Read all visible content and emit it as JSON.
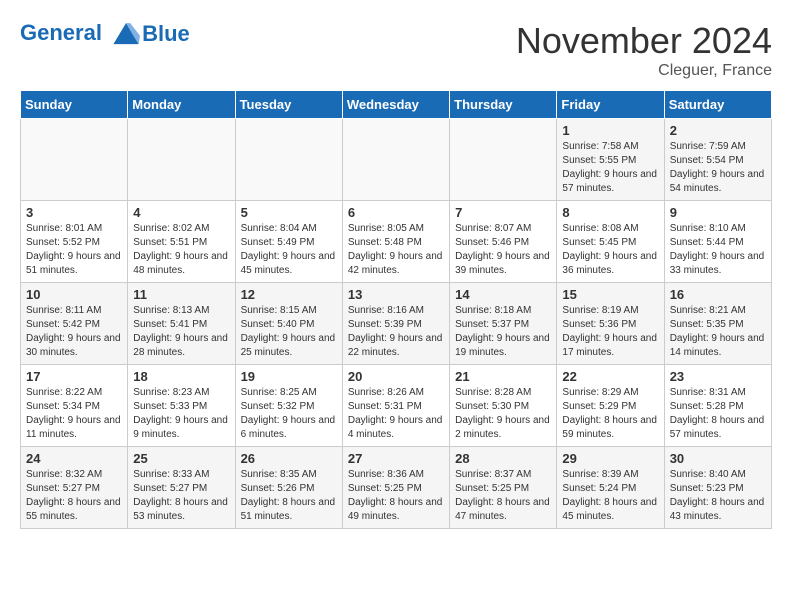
{
  "logo": {
    "line1": "General",
    "line2": "Blue"
  },
  "title": "November 2024",
  "subtitle": "Cleguer, France",
  "days_of_week": [
    "Sunday",
    "Monday",
    "Tuesday",
    "Wednesday",
    "Thursday",
    "Friday",
    "Saturday"
  ],
  "weeks": [
    [
      {
        "day": "",
        "info": ""
      },
      {
        "day": "",
        "info": ""
      },
      {
        "day": "",
        "info": ""
      },
      {
        "day": "",
        "info": ""
      },
      {
        "day": "",
        "info": ""
      },
      {
        "day": "1",
        "info": "Sunrise: 7:58 AM\nSunset: 5:55 PM\nDaylight: 9 hours and 57 minutes."
      },
      {
        "day": "2",
        "info": "Sunrise: 7:59 AM\nSunset: 5:54 PM\nDaylight: 9 hours and 54 minutes."
      }
    ],
    [
      {
        "day": "3",
        "info": "Sunrise: 8:01 AM\nSunset: 5:52 PM\nDaylight: 9 hours and 51 minutes."
      },
      {
        "day": "4",
        "info": "Sunrise: 8:02 AM\nSunset: 5:51 PM\nDaylight: 9 hours and 48 minutes."
      },
      {
        "day": "5",
        "info": "Sunrise: 8:04 AM\nSunset: 5:49 PM\nDaylight: 9 hours and 45 minutes."
      },
      {
        "day": "6",
        "info": "Sunrise: 8:05 AM\nSunset: 5:48 PM\nDaylight: 9 hours and 42 minutes."
      },
      {
        "day": "7",
        "info": "Sunrise: 8:07 AM\nSunset: 5:46 PM\nDaylight: 9 hours and 39 minutes."
      },
      {
        "day": "8",
        "info": "Sunrise: 8:08 AM\nSunset: 5:45 PM\nDaylight: 9 hours and 36 minutes."
      },
      {
        "day": "9",
        "info": "Sunrise: 8:10 AM\nSunset: 5:44 PM\nDaylight: 9 hours and 33 minutes."
      }
    ],
    [
      {
        "day": "10",
        "info": "Sunrise: 8:11 AM\nSunset: 5:42 PM\nDaylight: 9 hours and 30 minutes."
      },
      {
        "day": "11",
        "info": "Sunrise: 8:13 AM\nSunset: 5:41 PM\nDaylight: 9 hours and 28 minutes."
      },
      {
        "day": "12",
        "info": "Sunrise: 8:15 AM\nSunset: 5:40 PM\nDaylight: 9 hours and 25 minutes."
      },
      {
        "day": "13",
        "info": "Sunrise: 8:16 AM\nSunset: 5:39 PM\nDaylight: 9 hours and 22 minutes."
      },
      {
        "day": "14",
        "info": "Sunrise: 8:18 AM\nSunset: 5:37 PM\nDaylight: 9 hours and 19 minutes."
      },
      {
        "day": "15",
        "info": "Sunrise: 8:19 AM\nSunset: 5:36 PM\nDaylight: 9 hours and 17 minutes."
      },
      {
        "day": "16",
        "info": "Sunrise: 8:21 AM\nSunset: 5:35 PM\nDaylight: 9 hours and 14 minutes."
      }
    ],
    [
      {
        "day": "17",
        "info": "Sunrise: 8:22 AM\nSunset: 5:34 PM\nDaylight: 9 hours and 11 minutes."
      },
      {
        "day": "18",
        "info": "Sunrise: 8:23 AM\nSunset: 5:33 PM\nDaylight: 9 hours and 9 minutes."
      },
      {
        "day": "19",
        "info": "Sunrise: 8:25 AM\nSunset: 5:32 PM\nDaylight: 9 hours and 6 minutes."
      },
      {
        "day": "20",
        "info": "Sunrise: 8:26 AM\nSunset: 5:31 PM\nDaylight: 9 hours and 4 minutes."
      },
      {
        "day": "21",
        "info": "Sunrise: 8:28 AM\nSunset: 5:30 PM\nDaylight: 9 hours and 2 minutes."
      },
      {
        "day": "22",
        "info": "Sunrise: 8:29 AM\nSunset: 5:29 PM\nDaylight: 8 hours and 59 minutes."
      },
      {
        "day": "23",
        "info": "Sunrise: 8:31 AM\nSunset: 5:28 PM\nDaylight: 8 hours and 57 minutes."
      }
    ],
    [
      {
        "day": "24",
        "info": "Sunrise: 8:32 AM\nSunset: 5:27 PM\nDaylight: 8 hours and 55 minutes."
      },
      {
        "day": "25",
        "info": "Sunrise: 8:33 AM\nSunset: 5:27 PM\nDaylight: 8 hours and 53 minutes."
      },
      {
        "day": "26",
        "info": "Sunrise: 8:35 AM\nSunset: 5:26 PM\nDaylight: 8 hours and 51 minutes."
      },
      {
        "day": "27",
        "info": "Sunrise: 8:36 AM\nSunset: 5:25 PM\nDaylight: 8 hours and 49 minutes."
      },
      {
        "day": "28",
        "info": "Sunrise: 8:37 AM\nSunset: 5:25 PM\nDaylight: 8 hours and 47 minutes."
      },
      {
        "day": "29",
        "info": "Sunrise: 8:39 AM\nSunset: 5:24 PM\nDaylight: 8 hours and 45 minutes."
      },
      {
        "day": "30",
        "info": "Sunrise: 8:40 AM\nSunset: 5:23 PM\nDaylight: 8 hours and 43 minutes."
      }
    ]
  ]
}
